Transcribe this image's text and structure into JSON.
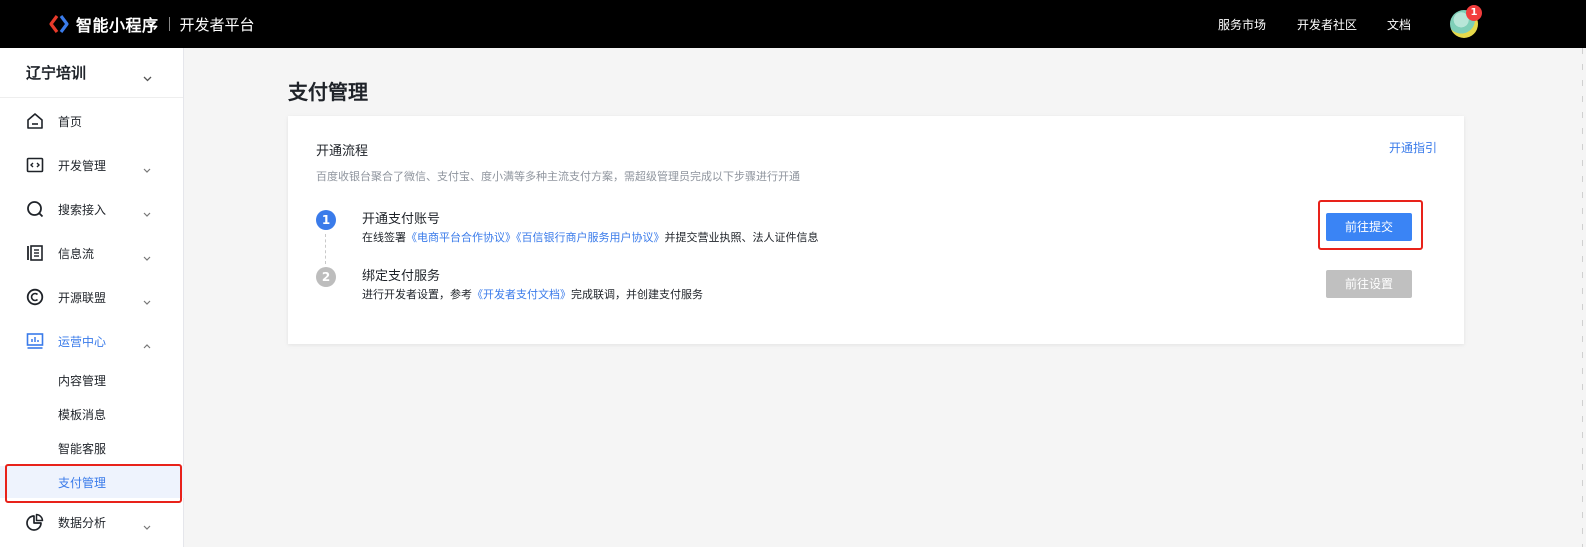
{
  "header": {
    "brand_name": "智能小程序",
    "brand_sub": "开发者平台",
    "nav": [
      "服务市场",
      "开发者社区",
      "文档"
    ],
    "notification_count": "1",
    "colors": {
      "bar": "#000000",
      "badge": "#f23c3c"
    }
  },
  "sidebar": {
    "org_name": "辽宁培训",
    "items": [
      {
        "label": "首页",
        "icon": "home-icon",
        "has_chevron": false
      },
      {
        "label": "开发管理",
        "icon": "code-icon",
        "has_chevron": true
      },
      {
        "label": "搜索接入",
        "icon": "search-icon",
        "has_chevron": true
      },
      {
        "label": "信息流",
        "icon": "feed-icon",
        "has_chevron": true
      },
      {
        "label": "开源联盟",
        "icon": "copyright-icon",
        "has_chevron": true
      },
      {
        "label": "运营中心",
        "icon": "dashboard-icon",
        "has_chevron": true,
        "expanded": true
      },
      {
        "label": "数据分析",
        "icon": "pie-chart-icon",
        "has_chevron": true
      }
    ],
    "sub_items": [
      "内容管理",
      "模板消息",
      "智能客服",
      "支付管理"
    ],
    "selected_sub": "支付管理"
  },
  "main": {
    "page_title": "支付管理",
    "card": {
      "title": "开通流程",
      "guide_link": "开通指引",
      "description": "百度收银台聚合了微信、支付宝、度小满等多种主流支付方案，需超级管理员完成以下步骤进行开通",
      "steps": [
        {
          "num": "1",
          "title": "开通支付账号",
          "desc_prefix": "在线签署",
          "link1": "《电商平台合作协议》",
          "link2": "《百信银行商户服务用户协议》",
          "desc_suffix": "并提交营业执照、法人证件信息",
          "button": "前往提交",
          "state": "active"
        },
        {
          "num": "2",
          "title": "绑定支付服务",
          "desc_prefix": "进行开发者设置，参考",
          "link1": "《开发者支付文档》",
          "desc_suffix": "完成联调，并创建支付服务",
          "button": "前往设置",
          "state": "disabled"
        }
      ]
    },
    "colors": {
      "primary": "#3a84f5",
      "link": "#3a7bea",
      "highlight": "#e8221a",
      "disabled": "#c0c0c0"
    }
  }
}
